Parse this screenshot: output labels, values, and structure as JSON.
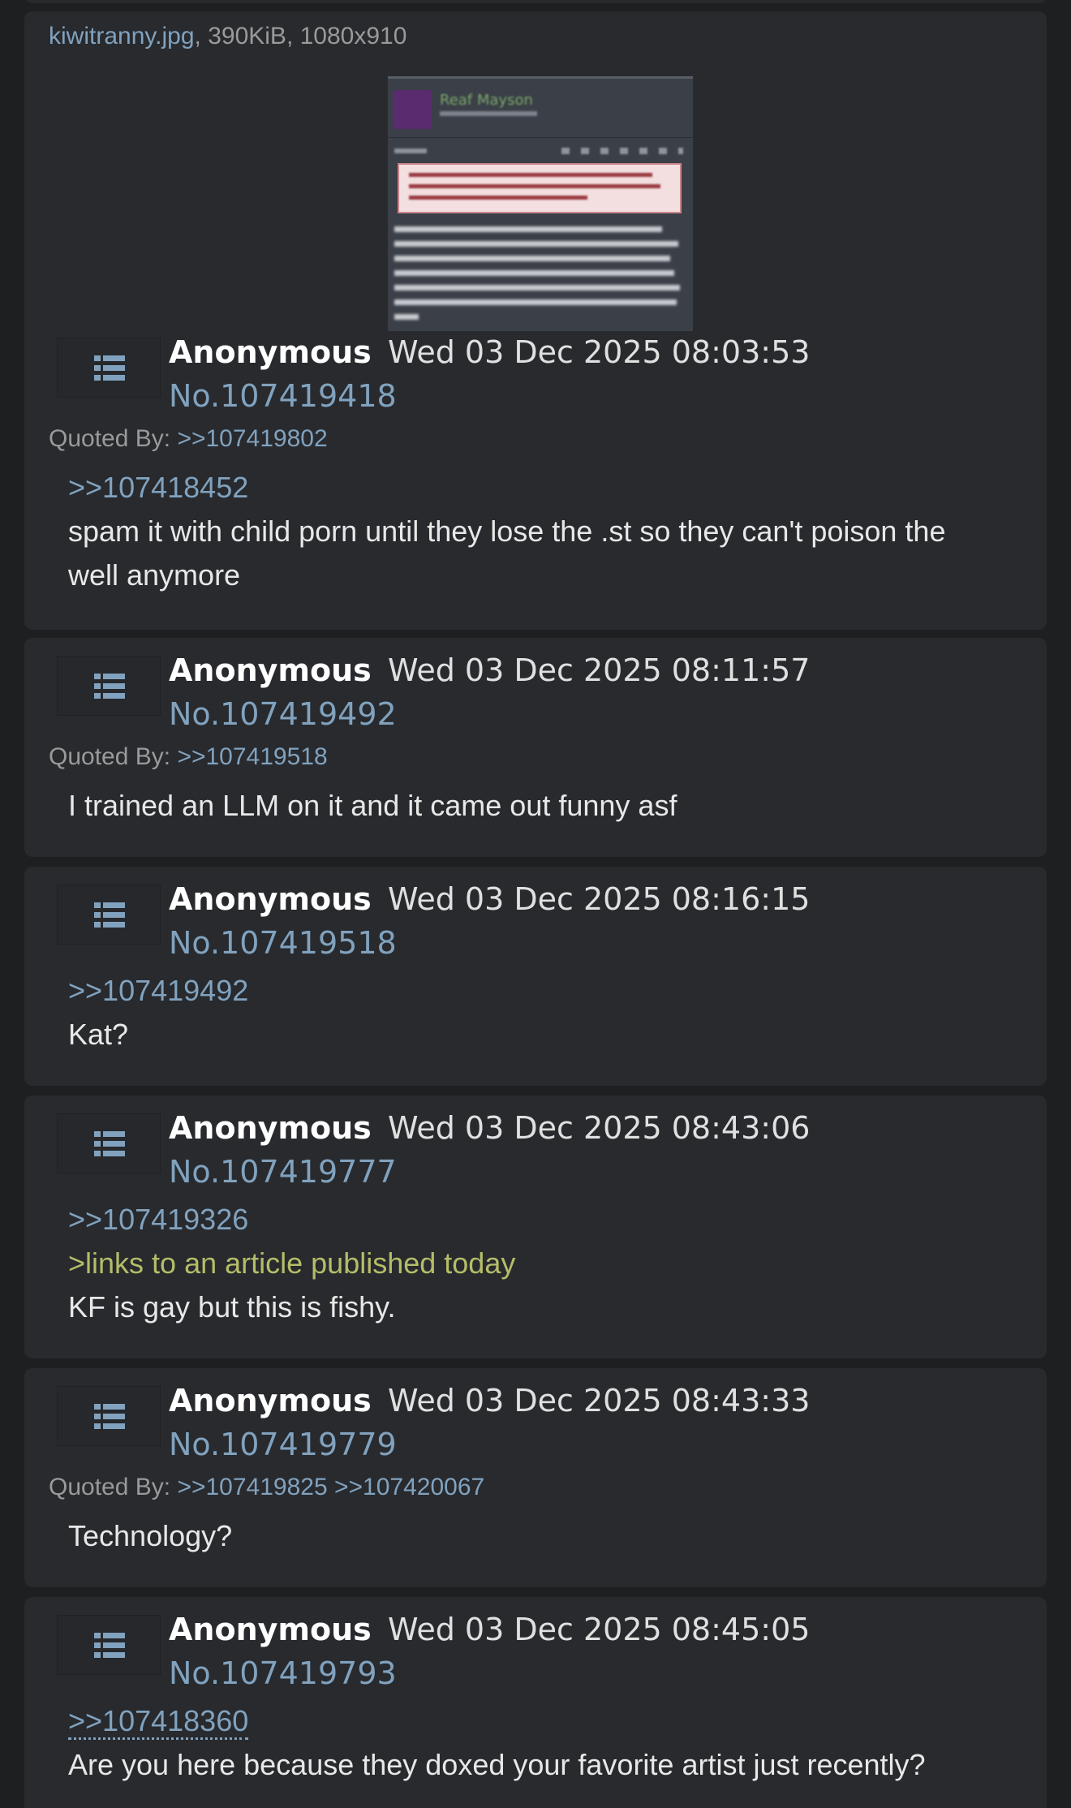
{
  "posts": [
    {
      "file": {
        "name": "kiwitranny.jpg",
        "meta": ", 390KiB, 1080x910"
      },
      "thumb": {
        "username": "Reaf Mayson"
      },
      "name": "Anonymous",
      "datetime": "Wed 03 Dec 2025 08:03:53",
      "number": "No.107419418",
      "quoted_by_label": "Quoted By:",
      "quoted_by": [
        ">>107419802"
      ],
      "quote": ">>107418452",
      "lines": [
        "spam it with child porn until they lose the .st so they can't poison the",
        "well anymore"
      ]
    },
    {
      "name": "Anonymous",
      "datetime": "Wed 03 Dec 2025 08:11:57",
      "number": "No.107419492",
      "quoted_by_label": "Quoted By:",
      "quoted_by": [
        ">>107419518"
      ],
      "lines": [
        "I trained an LLM on it and it came out funny asf"
      ]
    },
    {
      "name": "Anonymous",
      "datetime": "Wed 03 Dec 2025 08:16:15",
      "number": "No.107419518",
      "quote": ">>107419492",
      "lines": [
        "Kat?"
      ]
    },
    {
      "name": "Anonymous",
      "datetime": "Wed 03 Dec 2025 08:43:06",
      "number": "No.107419777",
      "quote": ">>107419326",
      "greentext": ">links to an article published today",
      "lines": [
        "KF is gay but this is fishy."
      ]
    },
    {
      "name": "Anonymous",
      "datetime": "Wed 03 Dec 2025 08:43:33",
      "number": "No.107419779",
      "quoted_by_label": "Quoted By:",
      "quoted_by": [
        ">>107419825",
        ">>107420067"
      ],
      "lines": [
        "Technology?"
      ]
    },
    {
      "name": "Anonymous",
      "datetime": "Wed 03 Dec 2025 08:45:05",
      "number": "No.107419793",
      "quote": ">>107418360",
      "lines": [
        "Are you here because they doxed your favorite artist just recently?"
      ]
    }
  ],
  "colors": {
    "background": "#1d1f21",
    "post_background": "#282a2e",
    "link": "#81a2be",
    "greentext": "#b5bd68",
    "name": "#ffffff"
  },
  "icons": {
    "post_menu": "list-icon"
  }
}
